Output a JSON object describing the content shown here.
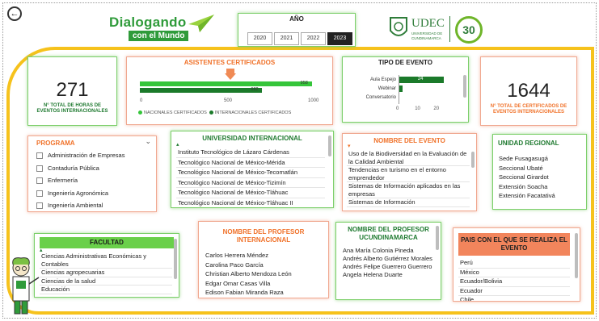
{
  "brand": {
    "line1": "Dialogando",
    "line2": "con el Mundo",
    "udec": "UDEC",
    "udec_sub1": "UNIVERSIDAD DE",
    "udec_sub2": "CUNDINAMARCA",
    "anniv": "30"
  },
  "year": {
    "title": "AÑO",
    "options": [
      "2020",
      "2021",
      "2022",
      "2023"
    ],
    "selected": "2023"
  },
  "kpi_hours": {
    "value": "271",
    "label": "N° TOTAL DE HORAS DE EVENTOS INTERNACIONALES"
  },
  "kpi_certs": {
    "value": "1644",
    "label": "N° TOTAL DE CERTIFICADOS DE EVENTOS INTERNACIONALES"
  },
  "asistentes": {
    "title": "ASISTENTES CERTIFICADOS",
    "legend": [
      "NACIONALES CERTIFICADOS",
      "INTERNACIONALES CERTIFICADOS"
    ],
    "colors": [
      "#35c53a",
      "#1b7a2a"
    ]
  },
  "tipo": {
    "title": "TIPO DE EVENTO"
  },
  "chart_data": [
    {
      "type": "bar",
      "title": "ASISTENTES CERTIFICADOS",
      "orientation": "horizontal",
      "series": [
        {
          "name": "NACIONALES CERTIFICADOS",
          "values": [
            958
          ]
        },
        {
          "name": "INTERNACIONALES CERTIFICADOS",
          "values": [
            682
          ]
        }
      ],
      "data_labels": [
        "958",
        "682"
      ],
      "xlim": [
        0,
        1000
      ],
      "xticks": [
        "0",
        "500",
        "1000"
      ],
      "legend": "bottom"
    },
    {
      "type": "bar",
      "title": "TIPO DE EVENTO",
      "orientation": "horizontal",
      "categories": [
        "Aula Espejo",
        "Webinar",
        "Conversatorio"
      ],
      "values": [
        24,
        2,
        0
      ],
      "data_labels": [
        "24",
        "",
        ""
      ],
      "xlim": [
        0,
        25
      ],
      "xticks": [
        "0",
        "10",
        "20"
      ]
    }
  ],
  "programa": {
    "title": "PROGRAMA",
    "items": [
      "Administración de Empresas",
      "Contaduría Pública",
      "Enfermería",
      "Ingeniería Agronómica",
      "Ingeniería Ambiental"
    ]
  },
  "univ": {
    "title": "UNIVERSIDAD INTERNACIONAL",
    "items": [
      "Instituto Tecnológico de Lázaro Cárdenas",
      "Tecnológico Nacional de México-Mérida",
      "Tecnológico Nacional de México-Tecomatlán",
      "Tecnológico Nacional de México-Tizimín",
      "Tecnológico Nacional de México-Tláhuac",
      "Tecnológico Nacional de México-Tláhuac II"
    ]
  },
  "evento": {
    "title": "NOMBRE DEL EVENTO",
    "items": [
      "Uso de la Biodiversidad en la Evaluación de la Calidad Ambiental",
      "Tendencias en turismo en el entorno emprendedor",
      "Sistemas de Información aplicados en las empresas",
      "Sistemas de Información"
    ]
  },
  "regional": {
    "title": "UNIDAD REGIONAL",
    "items": [
      "Sede Fusagasugá",
      "Seccional Ubaté",
      "Seccional Girardot",
      "Extensión Soacha",
      "Extensión Facatativá"
    ]
  },
  "facultad": {
    "title": "FACULTAD",
    "items": [
      "Ciencias Administrativas Económicas y Contables",
      "Ciencias agropecuarias",
      "Ciencias de la salud",
      "Educación"
    ]
  },
  "prof_int": {
    "title": "NOMBRE DEL PROFESOR INTERNACIONAL",
    "items": [
      "Carlos Herrera Méndez",
      "Carolina Paco García",
      "Christian Alberto Mendoza León",
      "Edgar Omar Casas Villa",
      "Edison Fabian Miranda Raza"
    ]
  },
  "prof_udec": {
    "title": "NOMBRE DEL PROFESOR UCUNDINAMARCA",
    "items": [
      "Ana María Colonia Pineda",
      "Andrés Alberto Gutiérrez Morales",
      "Andrés Felipe Guerrero Guerrero",
      "Angela Helena Duarte"
    ]
  },
  "pais": {
    "title": "PAIS CON EL QUE SE REALIZA EL EVENTO",
    "items": [
      "Perú",
      "México",
      "Ecuador/Bolivia",
      "Ecuador",
      "Chile"
    ]
  }
}
